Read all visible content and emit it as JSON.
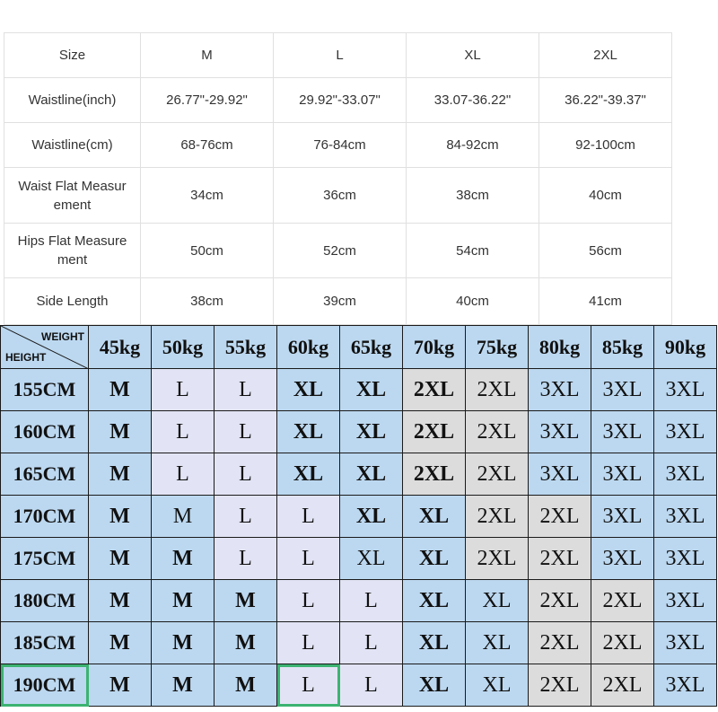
{
  "size_table": {
    "header": [
      "Size",
      "M",
      "L",
      "XL",
      "2XL"
    ],
    "rows": [
      [
        "Waistline(inch)",
        "26.77\"-29.92\"",
        "29.92\"-33.07\"",
        "33.07-36.22\"",
        "36.22\"-39.37\""
      ],
      [
        "Waistline(cm)",
        "68-76cm",
        "76-84cm",
        "84-92cm",
        "92-100cm"
      ],
      [
        "Waist Flat Measur ement",
        "34cm",
        "36cm",
        "38cm",
        "40cm"
      ],
      [
        "Hips Flat Measure ment",
        "50cm",
        "52cm",
        "54cm",
        "56cm"
      ],
      [
        "Side Length",
        "38cm",
        "39cm",
        "40cm",
        "41cm"
      ]
    ]
  },
  "weight_height_chart": {
    "corner_weight_label": "WEIGHT",
    "corner_height_label": "HEIGHT",
    "weights": [
      "45kg",
      "50kg",
      "55kg",
      "60kg",
      "65kg",
      "70kg",
      "75kg",
      "80kg",
      "85kg",
      "90kg"
    ],
    "rows": [
      {
        "height": "155CM",
        "sizes": [
          "M",
          "L",
          "L",
          "XL",
          "XL",
          "2XL",
          "2XL",
          "3XL",
          "3XL",
          "3XL"
        ]
      },
      {
        "height": "160CM",
        "sizes": [
          "M",
          "L",
          "L",
          "XL",
          "XL",
          "2XL",
          "2XL",
          "3XL",
          "3XL",
          "3XL"
        ]
      },
      {
        "height": "165CM",
        "sizes": [
          "M",
          "L",
          "L",
          "XL",
          "XL",
          "2XL",
          "2XL",
          "3XL",
          "3XL",
          "3XL"
        ]
      },
      {
        "height": "170CM",
        "sizes": [
          "M",
          "M",
          "L",
          "L",
          "XL",
          "XL",
          "2XL",
          "2XL",
          "3XL",
          "3XL"
        ]
      },
      {
        "height": "175CM",
        "sizes": [
          "M",
          "M",
          "L",
          "L",
          "XL",
          "XL",
          "2XL",
          "2XL",
          "3XL",
          "3XL"
        ]
      },
      {
        "height": "180CM",
        "sizes": [
          "M",
          "M",
          "M",
          "L",
          "L",
          "XL",
          "XL",
          "2XL",
          "2XL",
          "3XL"
        ]
      },
      {
        "height": "185CM",
        "sizes": [
          "M",
          "M",
          "M",
          "L",
          "L",
          "XL",
          "XL",
          "2XL",
          "2XL",
          "3XL"
        ]
      },
      {
        "height": "190CM",
        "sizes": [
          "M",
          "M",
          "M",
          "L",
          "L",
          "XL",
          "XL",
          "2XL",
          "2XL",
          "3XL"
        ]
      }
    ],
    "colors": {
      "blue": "#bcd8f0",
      "lavender": "#e2e4f5",
      "gray": "#dcdcdc",
      "highlight": "#3cb371"
    }
  }
}
